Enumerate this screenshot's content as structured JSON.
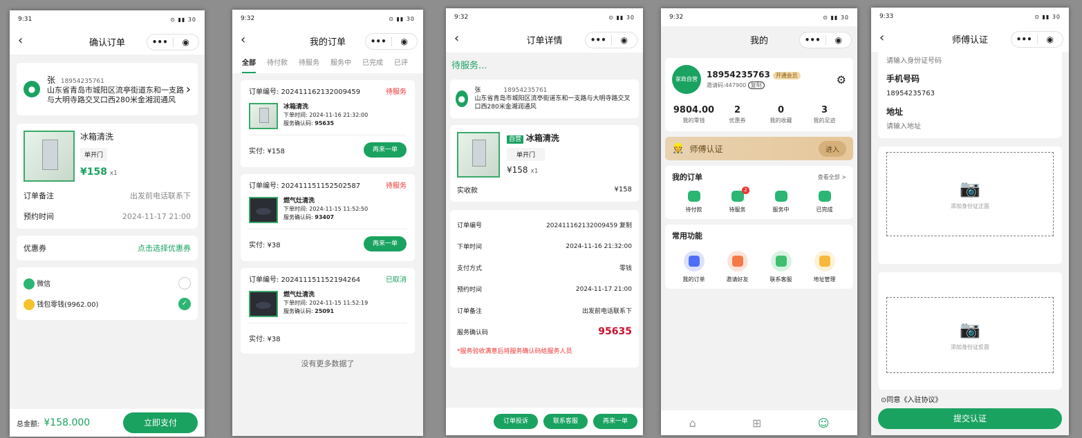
{
  "accent": "#1aa260",
  "s1": {
    "time": "9:31",
    "title": "确认订单",
    "name": "张",
    "phone": "18954235761",
    "address": "山东省青岛市城阳区流亭街道东和一支路与大明寺路交叉口西280米金湘润通风",
    "product": "冰箱清洗",
    "spec": "单开门",
    "price": "¥158",
    "qty": "x1",
    "remark_label": "订单备注",
    "remark": "出发前电话联系下",
    "appt_label": "预约时间",
    "appt": "2024-11-17 21:00",
    "coupon_label": "优惠券",
    "coupon_action": "点击选择优惠券",
    "pay1": "微信",
    "pay2": "钱包零钱(9962.00)",
    "total_label": "总金额:",
    "total": "¥158.000",
    "pay_btn": "立即支付"
  },
  "s2": {
    "time": "9:32",
    "title": "我的订单",
    "tabs": [
      "全部",
      "待付款",
      "待服务",
      "服务中",
      "已完成",
      "已评"
    ],
    "orders": [
      {
        "no": "订单编号: 202411162132009459",
        "status": "待服务",
        "name": "冰箱清洗",
        "time": "下单时间: 2024-11-16 21:32:00",
        "code_label": "服务确认码:",
        "code": "95635",
        "paid": "实付: ¥158",
        "btn": "再来一单"
      },
      {
        "no": "订单编号: 202411151152502587",
        "status": "待服务",
        "name": "燃气灶清洗",
        "time": "下单时间: 2024-11-15 11:52:50",
        "code_label": "服务确认码:",
        "code": "93407",
        "paid": "实付: ¥38",
        "btn": "再来一单"
      },
      {
        "no": "订单编号: 202411151152194264",
        "status": "已取消",
        "name": "燃气灶清洗",
        "time": "下单时间: 2024-11-15 11:52:19",
        "code_label": "服务确认码:",
        "code": "25091",
        "paid": "实付: ¥38"
      }
    ],
    "nomore": "没有更多数据了"
  },
  "s3": {
    "time": "9:32",
    "title": "订单详情",
    "state": "待服务...",
    "name": "张",
    "phone": "18954235761",
    "address": "山东省青岛市城阳区流亭街道东和一支路与大明寺路交叉口西280米金湘润通风",
    "tag": "自营",
    "product": "冰箱清洗",
    "spec": "单开门",
    "price": "¥158",
    "qty": "x1",
    "received_label": "实收款",
    "received": "¥158",
    "rows": [
      {
        "k": "订单编号",
        "v": "202411162132009459 复制"
      },
      {
        "k": "下单时间",
        "v": "2024-11-16 21:32:00"
      },
      {
        "k": "支付方式",
        "v": "零钱"
      },
      {
        "k": "预约时间",
        "v": "2024-11-17 21:00"
      },
      {
        "k": "订单备注",
        "v": "出发前电话联系下"
      }
    ],
    "code_label": "服务确认码",
    "code": "95635",
    "notice": "*服务验收满意后将服务确认码给服务人员",
    "btns": [
      "订单投诉",
      "联系客服",
      "再来一单"
    ]
  },
  "s4": {
    "time": "9:32",
    "title": "我的",
    "avatar": "家政自营",
    "phone": "18954235763",
    "vip": "开通会员",
    "invite": "邀请码:447900",
    "copy": "复制",
    "stats": [
      {
        "v": "9804.00",
        "l": "我的零钱"
      },
      {
        "v": "2",
        "l": "优惠券"
      },
      {
        "v": "0",
        "l": "我的收藏"
      },
      {
        "v": "3",
        "l": "我的足迹"
      }
    ],
    "master": "师傅认证",
    "enter": "进入",
    "orders_title": "我的订单",
    "view_all": "查看全部 >",
    "order_icons": [
      {
        "l": "待付款",
        "c": "#2bb673"
      },
      {
        "l": "待服务",
        "c": "#2bb673",
        "badge": "2"
      },
      {
        "l": "服务中",
        "c": "#2bb673"
      },
      {
        "l": "已完成",
        "c": "#2bb673"
      }
    ],
    "func_title": "常用功能",
    "funcs": [
      {
        "l": "我的订单",
        "c": "#4f6ef7"
      },
      {
        "l": "邀请好友",
        "c": "#f47a4a"
      },
      {
        "l": "联系客服",
        "c": "#3fbf6f"
      },
      {
        "l": "地址管理",
        "c": "#f6b93b"
      }
    ]
  },
  "s5": {
    "time": "9:33",
    "title": "师傅认证",
    "id_ph": "请输入身份证号码",
    "phone_label": "手机号码",
    "phone": "18954235763",
    "addr_label": "地址",
    "addr_ph": "请输入地址",
    "front": "添加身份证正面",
    "back": "添加身份证反面",
    "agree": "⊙同意《入驻协议》",
    "submit": "提交认证"
  }
}
